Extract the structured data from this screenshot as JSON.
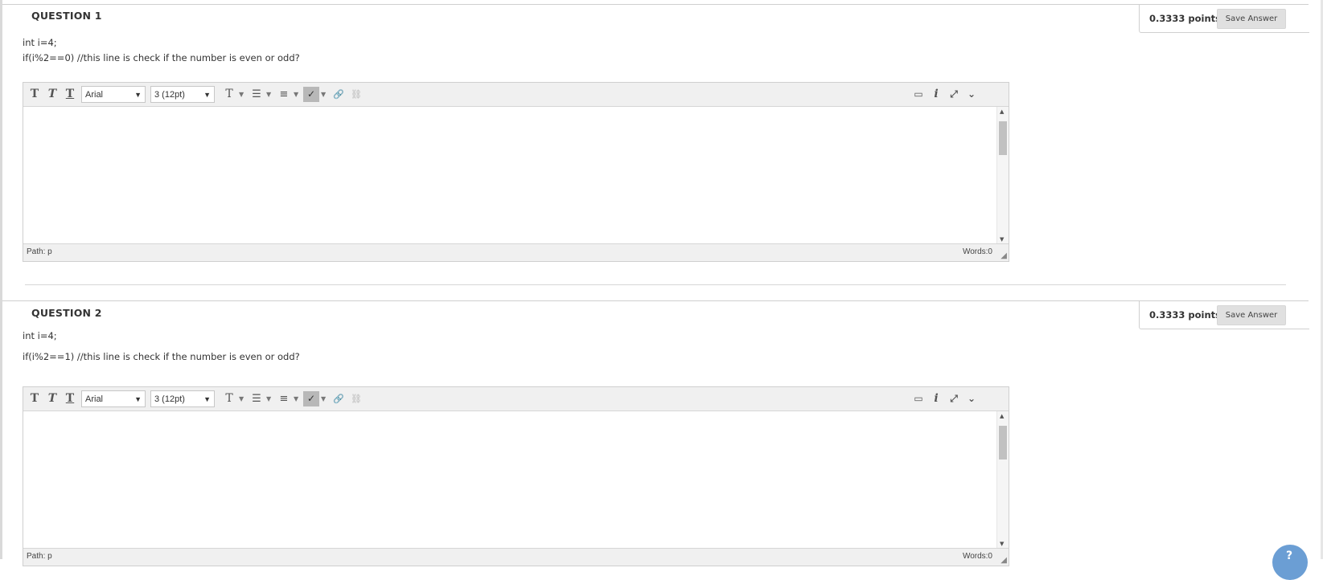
{
  "questions": [
    {
      "title": "QUESTION 1",
      "points": "0.3333 points",
      "save_label": "Save Answer",
      "lines": [
        "int i=4;",
        "if(i%2==0) //this line is check if the number is even or odd?"
      ],
      "editor": {
        "font": "Arial",
        "size": "3 (12pt)",
        "path_label": "Path:",
        "path_value": "p",
        "words": "Words:0"
      }
    },
    {
      "title": "QUESTION 2",
      "points": "0.3333 points",
      "save_label": "Save Answer",
      "lines": [
        "int i=4;",
        "if(i%2==1) //this line is check if the number is even or odd?"
      ],
      "editor": {
        "font": "Arial",
        "size": "3 (12pt)",
        "path_label": "Path:",
        "path_value": "p",
        "words": "Words:0"
      }
    }
  ],
  "icons": {
    "bold": "bold-t-icon",
    "italic": "italic-t-icon",
    "underline": "underline-t-icon",
    "text-color": "text-color-icon",
    "bullet-list": "bullet-list-icon",
    "numbered-list": "numbered-list-icon",
    "spellcheck": "spellcheck-icon",
    "link": "link-icon",
    "unlink": "unlink-icon",
    "preview": "monitor-icon",
    "info": "info-icon",
    "fullscreen": "fullscreen-icon",
    "expand": "double-chevron-down-icon"
  },
  "colors": {
    "save_button_bg": "#e0e0e0",
    "toolbar_bg": "#f0f0f0",
    "help_bubble": "#6b9ed4"
  }
}
